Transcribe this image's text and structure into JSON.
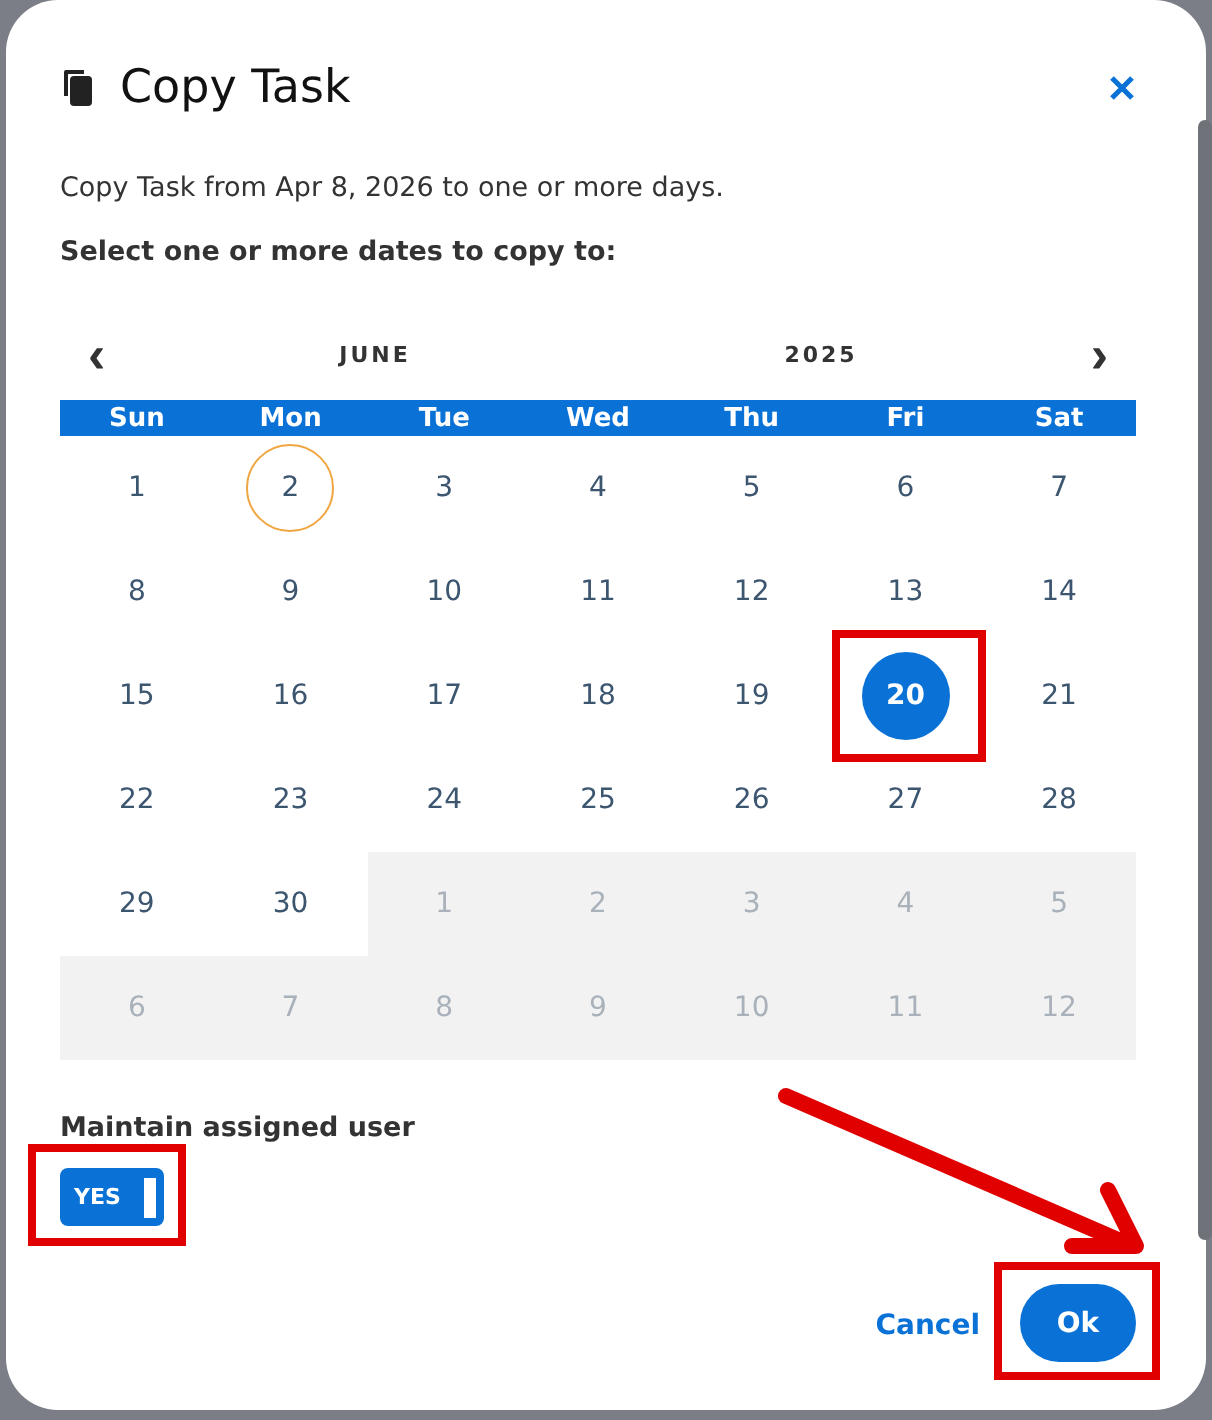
{
  "dialog": {
    "title": "Copy Task",
    "description": "Copy Task from Apr 8, 2026 to one or more days.",
    "prompt": "Select one or more dates to copy to:"
  },
  "calendar": {
    "prev": "‹",
    "next": "›",
    "month": "JUNE",
    "year": "2025",
    "weekdays": [
      "Sun",
      "Mon",
      "Tue",
      "Wed",
      "Thu",
      "Fri",
      "Sat"
    ],
    "weeks": [
      [
        {
          "label": "1",
          "in_month": true,
          "today": false,
          "selected": false,
          "highlighted": false
        },
        {
          "label": "2",
          "in_month": true,
          "today": true,
          "selected": false,
          "highlighted": false
        },
        {
          "label": "3",
          "in_month": true,
          "today": false,
          "selected": false,
          "highlighted": false
        },
        {
          "label": "4",
          "in_month": true,
          "today": false,
          "selected": false,
          "highlighted": false
        },
        {
          "label": "5",
          "in_month": true,
          "today": false,
          "selected": false,
          "highlighted": false
        },
        {
          "label": "6",
          "in_month": true,
          "today": false,
          "selected": false,
          "highlighted": false
        },
        {
          "label": "7",
          "in_month": true,
          "today": false,
          "selected": false,
          "highlighted": false
        }
      ],
      [
        {
          "label": "8",
          "in_month": true,
          "today": false,
          "selected": false,
          "highlighted": false
        },
        {
          "label": "9",
          "in_month": true,
          "today": false,
          "selected": false,
          "highlighted": false
        },
        {
          "label": "10",
          "in_month": true,
          "today": false,
          "selected": false,
          "highlighted": false
        },
        {
          "label": "11",
          "in_month": true,
          "today": false,
          "selected": false,
          "highlighted": false
        },
        {
          "label": "12",
          "in_month": true,
          "today": false,
          "selected": false,
          "highlighted": false
        },
        {
          "label": "13",
          "in_month": true,
          "today": false,
          "selected": false,
          "highlighted": false
        },
        {
          "label": "14",
          "in_month": true,
          "today": false,
          "selected": false,
          "highlighted": false
        }
      ],
      [
        {
          "label": "15",
          "in_month": true,
          "today": false,
          "selected": false,
          "highlighted": false
        },
        {
          "label": "16",
          "in_month": true,
          "today": false,
          "selected": false,
          "highlighted": false
        },
        {
          "label": "17",
          "in_month": true,
          "today": false,
          "selected": false,
          "highlighted": false
        },
        {
          "label": "18",
          "in_month": true,
          "today": false,
          "selected": false,
          "highlighted": false
        },
        {
          "label": "19",
          "in_month": true,
          "today": false,
          "selected": false,
          "highlighted": false
        },
        {
          "label": "20",
          "in_month": true,
          "today": false,
          "selected": true,
          "highlighted": true
        },
        {
          "label": "21",
          "in_month": true,
          "today": false,
          "selected": false,
          "highlighted": false
        }
      ],
      [
        {
          "label": "22",
          "in_month": true,
          "today": false,
          "selected": false,
          "highlighted": false
        },
        {
          "label": "23",
          "in_month": true,
          "today": false,
          "selected": false,
          "highlighted": false
        },
        {
          "label": "24",
          "in_month": true,
          "today": false,
          "selected": false,
          "highlighted": false
        },
        {
          "label": "25",
          "in_month": true,
          "today": false,
          "selected": false,
          "highlighted": false
        },
        {
          "label": "26",
          "in_month": true,
          "today": false,
          "selected": false,
          "highlighted": false
        },
        {
          "label": "27",
          "in_month": true,
          "today": false,
          "selected": false,
          "highlighted": false
        },
        {
          "label": "28",
          "in_month": true,
          "today": false,
          "selected": false,
          "highlighted": false
        }
      ],
      [
        {
          "label": "29",
          "in_month": true,
          "today": false,
          "selected": false,
          "highlighted": false
        },
        {
          "label": "30",
          "in_month": true,
          "today": false,
          "selected": false,
          "highlighted": false
        },
        {
          "label": "1",
          "in_month": false,
          "today": false,
          "selected": false,
          "highlighted": false
        },
        {
          "label": "2",
          "in_month": false,
          "today": false,
          "selected": false,
          "highlighted": false
        },
        {
          "label": "3",
          "in_month": false,
          "today": false,
          "selected": false,
          "highlighted": false
        },
        {
          "label": "4",
          "in_month": false,
          "today": false,
          "selected": false,
          "highlighted": false
        },
        {
          "label": "5",
          "in_month": false,
          "today": false,
          "selected": false,
          "highlighted": false
        }
      ],
      [
        {
          "label": "6",
          "in_month": false,
          "today": false,
          "selected": false,
          "highlighted": false
        },
        {
          "label": "7",
          "in_month": false,
          "today": false,
          "selected": false,
          "highlighted": false
        },
        {
          "label": "8",
          "in_month": false,
          "today": false,
          "selected": false,
          "highlighted": false
        },
        {
          "label": "9",
          "in_month": false,
          "today": false,
          "selected": false,
          "highlighted": false
        },
        {
          "label": "10",
          "in_month": false,
          "today": false,
          "selected": false,
          "highlighted": false
        },
        {
          "label": "11",
          "in_month": false,
          "today": false,
          "selected": false,
          "highlighted": false
        },
        {
          "label": "12",
          "in_month": false,
          "today": false,
          "selected": false,
          "highlighted": false
        }
      ]
    ]
  },
  "maintain_user": {
    "label": "Maintain assigned user",
    "toggle": "YES",
    "on": true,
    "highlighted": true
  },
  "buttons": [
    {
      "label": "Cancel",
      "kind": "link"
    },
    {
      "label": "Ok",
      "kind": "primary",
      "highlighted": true
    }
  ]
}
